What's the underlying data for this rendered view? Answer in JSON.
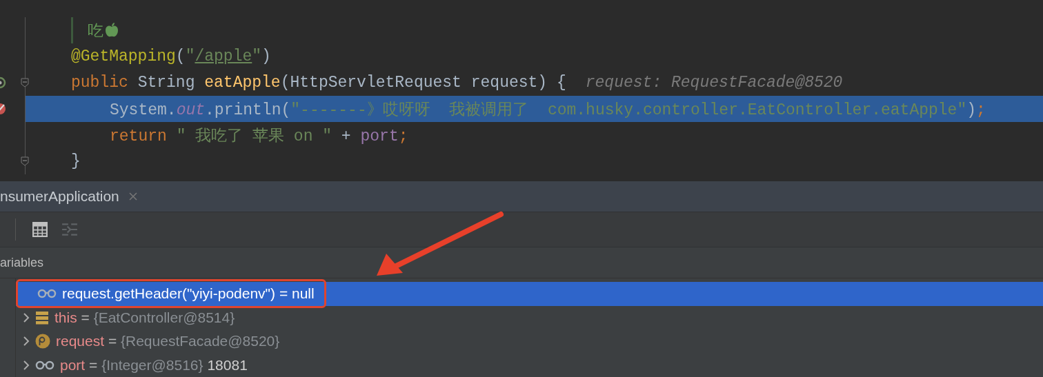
{
  "editor": {
    "lines": [
      {
        "kind": "doc",
        "selected": false,
        "fold": false,
        "breakpoint": false,
        "debug_marker": false,
        "tokens": [
          {
            "kind": "doc",
            "text": "吃"
          }
        ]
      },
      {
        "kind": "code",
        "selected": false,
        "fold": false,
        "breakpoint": false,
        "debug_marker": false,
        "tokens": [
          {
            "kind": "annotation",
            "text": "@GetMapping"
          },
          {
            "kind": "plain",
            "text": "("
          },
          {
            "kind": "string",
            "text": "\""
          },
          {
            "kind": "link",
            "text": "/apple"
          },
          {
            "kind": "string",
            "text": "\""
          },
          {
            "kind": "plain",
            "text": ")"
          }
        ]
      },
      {
        "kind": "code",
        "selected": false,
        "fold": true,
        "breakpoint": false,
        "debug_marker": true,
        "tokens": [
          {
            "kind": "keyword",
            "text": "public "
          },
          {
            "kind": "plain",
            "text": "String "
          },
          {
            "kind": "method",
            "text": "eatApple"
          },
          {
            "kind": "plain",
            "text": "(HttpServletRequest "
          },
          {
            "kind": "param",
            "text": "request"
          },
          {
            "kind": "plain",
            "text": ") {"
          }
        ],
        "hint": "request: RequestFacade@8520",
        "children": [
          {
            "kind": "code",
            "selected": true,
            "fold": false,
            "breakpoint": true,
            "debug_marker": false,
            "tokens": [
              {
                "kind": "plain",
                "text": "System."
              },
              {
                "kind": "field",
                "text": "out"
              },
              {
                "kind": "plain",
                "text": ".println("
              },
              {
                "kind": "string",
                "text": "\"-------》哎呀呀  我被调用了  com.husky.controller.EatController.eatApple\""
              },
              {
                "kind": "plain",
                "text": ")"
              },
              {
                "kind": "keyword",
                "text": ";"
              }
            ]
          },
          {
            "kind": "code",
            "selected": false,
            "fold": false,
            "breakpoint": false,
            "debug_marker": false,
            "tokens": [
              {
                "kind": "keyword",
                "text": "return "
              },
              {
                "kind": "string",
                "text": "\" 我吃了 苹果 on \""
              },
              {
                "kind": "plain",
                "text": " + "
              },
              {
                "kind": "var",
                "text": "port"
              },
              {
                "kind": "keyword",
                "text": ";"
              }
            ]
          }
        ]
      },
      {
        "kind": "code",
        "selected": false,
        "fold": true,
        "breakpoint": false,
        "debug_marker": false,
        "tokens": [
          {
            "kind": "plain",
            "text": "}"
          }
        ]
      }
    ]
  },
  "debug_panel": {
    "tab": {
      "label": "nsumerApplication"
    },
    "toolbar": [
      {
        "kind": "calculator",
        "disabled": false
      },
      {
        "kind": "list",
        "disabled": true
      }
    ],
    "variables": {
      "title": "ariables",
      "items": [
        {
          "kind": "watch",
          "expandable": false,
          "selected": true,
          "annotated": true,
          "name": "request.getHeader(\"yiyi-podenv\")",
          "separator": "=",
          "value": "null"
        },
        {
          "kind": "field",
          "expandable": true,
          "selected": false,
          "annotated": false,
          "name": "this",
          "separator": "=",
          "value": "{EatController@8514}"
        },
        {
          "kind": "parameter",
          "expandable": true,
          "selected": false,
          "annotated": false,
          "name": "request",
          "separator": "=",
          "value": "{RequestFacade@8520}"
        },
        {
          "kind": "watch",
          "expandable": true,
          "selected": false,
          "annotated": false,
          "name": "port",
          "separator": "=",
          "value": "{Integer@8516}",
          "display": "18081"
        }
      ]
    }
  }
}
